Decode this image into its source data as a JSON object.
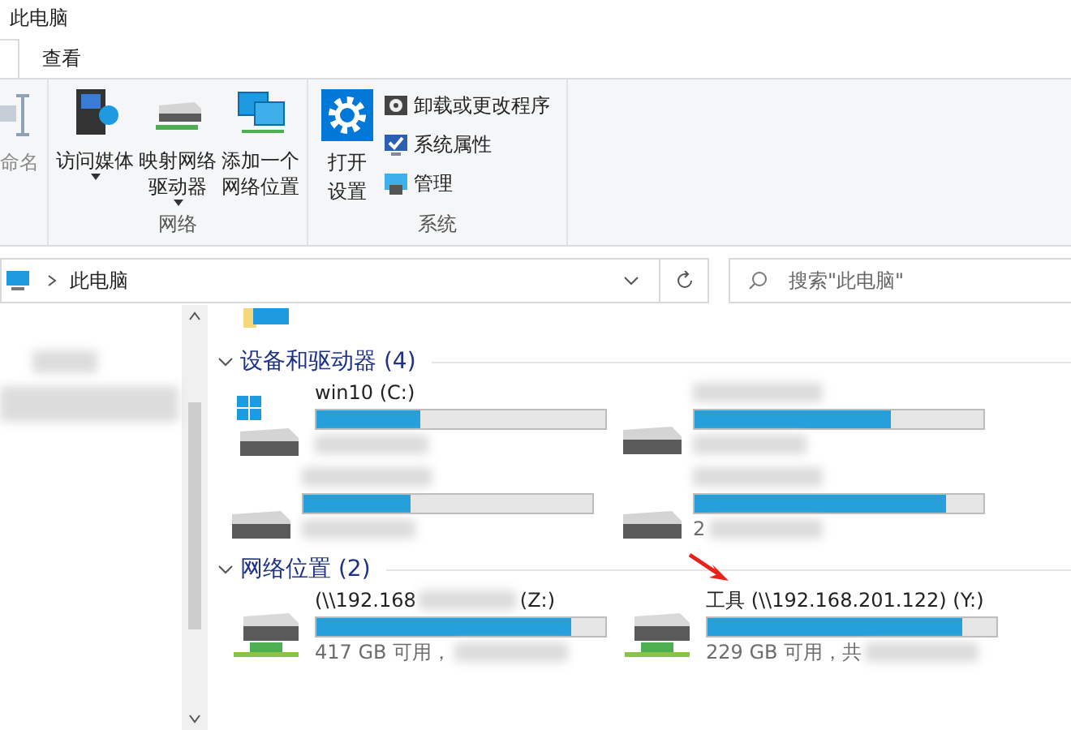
{
  "window": {
    "title": "此电脑"
  },
  "tabs": [
    {
      "label": "查看",
      "selected": false
    }
  ],
  "ribbon": {
    "partial_button": "命名",
    "groups": [
      {
        "label": "网络",
        "buttons": [
          {
            "kind": "media",
            "lines": [
              "访问媒体"
            ],
            "dropdown": true
          },
          {
            "kind": "map-drive",
            "lines": [
              "映射网络",
              "驱动器"
            ],
            "dropdown": true
          },
          {
            "kind": "add-location",
            "lines": [
              "添加一个",
              "网络位置"
            ],
            "dropdown": false
          }
        ]
      },
      {
        "label": "系统",
        "large": {
          "kind": "settings",
          "lines": [
            "打开",
            "设置"
          ]
        },
        "small": [
          {
            "kind": "uninstall",
            "label": "卸载或更改程序"
          },
          {
            "kind": "properties",
            "label": "系统属性"
          },
          {
            "kind": "manage",
            "label": "管理"
          }
        ]
      }
    ]
  },
  "address": {
    "path": "此电脑"
  },
  "search": {
    "placeholder": "搜索\"此电脑\""
  },
  "groups": [
    {
      "title": "设备和驱动器 (4)",
      "expanded": true,
      "items": [
        {
          "kind": "system",
          "name": "win10 (C:)",
          "level": 0.36
        },
        {
          "kind": "local",
          "level": 0.68
        },
        {
          "kind": "local",
          "level": 0.37
        },
        {
          "kind": "local",
          "level": 0.87,
          "free": "2"
        }
      ]
    },
    {
      "title": "网络位置 (2)",
      "expanded": true,
      "items": [
        {
          "kind": "network",
          "name": "(\\\\192.168",
          "name_end": "(Z:)",
          "level": 0.88,
          "free": "417 GB 可用，"
        },
        {
          "kind": "network",
          "name": "工具 (\\\\192.168.201.122) (Y:)",
          "level": 0.88,
          "free": "229 GB 可用，共",
          "highlighted": true
        }
      ]
    }
  ]
}
